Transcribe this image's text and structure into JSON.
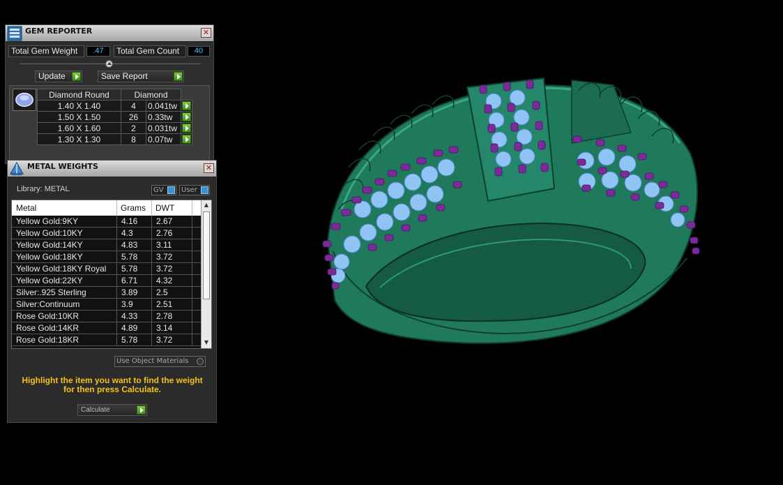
{
  "gem_reporter": {
    "title": "GEM REPORTER",
    "total_weight_label": "Total Gem Weight",
    "total_weight_value": ".47",
    "total_count_label": "Total Gem Count",
    "total_count_value": "40",
    "update_label": "Update",
    "save_report_label": "Save Report",
    "table_header_shape": "Diamond Round",
    "table_header_material": "Diamond",
    "rows": [
      {
        "size": "1.40 X 1.40",
        "count": "4",
        "weight": "0.041tw"
      },
      {
        "size": "1.50 X 1.50",
        "count": "26",
        "weight": "0.33tw"
      },
      {
        "size": "1.60 X 1.60",
        "count": "2",
        "weight": "0.031tw"
      },
      {
        "size": "1.30 X 1.30",
        "count": "8",
        "weight": "0.07tw"
      }
    ]
  },
  "metal_weights": {
    "title": "METAL WEIGHTS",
    "library_label": "Library: METAL",
    "gv_label": "GV",
    "user_label": "User",
    "col_metal": "Metal",
    "col_grams": "Grams",
    "col_dwt": "DWT",
    "rows": [
      {
        "metal": "Yellow Gold:9KY",
        "grams": "4.16",
        "dwt": "2.67"
      },
      {
        "metal": "Yellow Gold:10KY",
        "grams": "4.3",
        "dwt": "2.76"
      },
      {
        "metal": "Yellow Gold:14KY",
        "grams": "4.83",
        "dwt": "3.11"
      },
      {
        "metal": "Yellow Gold:18KY",
        "grams": "5.78",
        "dwt": "3.72"
      },
      {
        "metal": "Yellow Gold:18KY Royal",
        "grams": "5.78",
        "dwt": "3.72"
      },
      {
        "metal": "Yellow Gold:22KY",
        "grams": "6.71",
        "dwt": "4.32"
      },
      {
        "metal": "Silver:.925 Sterling",
        "grams": "3.89",
        "dwt": "2.5"
      },
      {
        "metal": "Silver:Continuum",
        "grams": "3.9",
        "dwt": "2.51"
      },
      {
        "metal": "Rose Gold:10KR",
        "grams": "4.33",
        "dwt": "2.78"
      },
      {
        "metal": "Rose Gold:14KR",
        "grams": "4.89",
        "dwt": "3.14"
      },
      {
        "metal": "Rose Gold:18KR",
        "grams": "5.78",
        "dwt": "3.72"
      }
    ],
    "use_object_materials_label": "Use Object Materials",
    "hint_line1": "Highlight the item you want to find the weight",
    "hint_line2": "for then press Calculate.",
    "calculate_label": "Calculate"
  },
  "colors": {
    "ring_metal": "#1f7a5c",
    "gem_stone": "#8fc4f4",
    "prong": "#7a2a9a",
    "hint_text": "#f2c21a",
    "value_text": "#4fc3ff"
  }
}
